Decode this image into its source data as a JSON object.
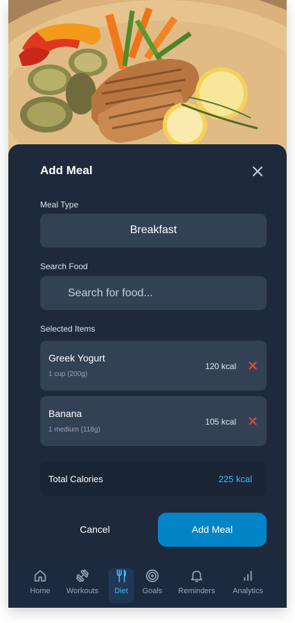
{
  "sheet": {
    "title": "Add Meal",
    "meal_type_label": "Meal Type",
    "meal_type_value": "Breakfast",
    "search_label": "Search Food",
    "search_placeholder": "Search for food...",
    "selected_label": "Selected Items",
    "items": [
      {
        "name": "Greek Yogurt",
        "detail": "1 cup (200g)",
        "kcal": "120 kcal"
      },
      {
        "name": "Banana",
        "detail": "1 medium (118g)",
        "kcal": "105 kcal"
      }
    ],
    "total_label": "Total Calories",
    "total_value": "225 kcal",
    "cancel_label": "Cancel",
    "add_label": "Add Meal"
  },
  "nav": {
    "items": [
      {
        "label": "Home",
        "icon": "home-icon"
      },
      {
        "label": "Workouts",
        "icon": "dumbbell-icon"
      },
      {
        "label": "Diet",
        "icon": "utensils-icon",
        "active": true
      },
      {
        "label": "Goals",
        "icon": "target-icon"
      },
      {
        "label": "Reminders",
        "icon": "bell-icon"
      },
      {
        "label": "Analytics",
        "icon": "bar-chart-icon"
      }
    ]
  },
  "colors": {
    "accent": "#38bdf8",
    "primary_button": "#0284c7",
    "remove": "#ef4444",
    "sheet_bg": "#1e293b",
    "field_bg": "#334155"
  }
}
